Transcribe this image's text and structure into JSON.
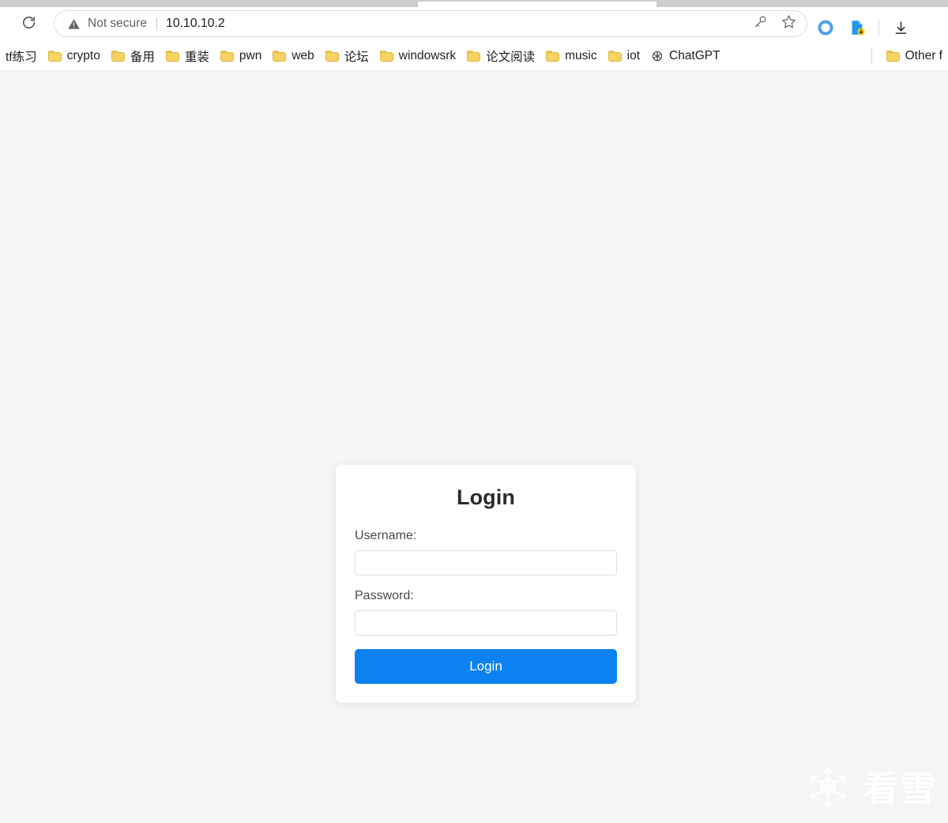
{
  "browser": {
    "tab": {
      "title": ""
    },
    "reload_label": "Reload",
    "omnibox": {
      "security_icon": "warning-triangle-icon",
      "security_label": "Not secure",
      "url": "10.10.10.2",
      "action_icons": [
        "key-icon",
        "star-icon"
      ]
    },
    "toolbar_icons": [
      "copilot-icon",
      "downloads-page-icon",
      "download-icon"
    ],
    "bookmarks": {
      "items": [
        {
          "label": "tf练习",
          "icon": "folder-icon"
        },
        {
          "label": "crypto",
          "icon": "folder-icon"
        },
        {
          "label": "备用",
          "icon": "folder-icon"
        },
        {
          "label": "重装",
          "icon": "folder-icon"
        },
        {
          "label": "pwn",
          "icon": "folder-icon"
        },
        {
          "label": "web",
          "icon": "folder-icon"
        },
        {
          "label": "论坛",
          "icon": "folder-icon"
        },
        {
          "label": "windowsrk",
          "icon": "folder-icon"
        },
        {
          "label": "论文阅读",
          "icon": "folder-icon"
        },
        {
          "label": "music",
          "icon": "folder-icon"
        },
        {
          "label": "iot",
          "icon": "folder-icon"
        },
        {
          "label": "ChatGPT",
          "icon": "openai-icon"
        }
      ],
      "other_folder": {
        "label": "Other f",
        "icon": "folder-icon"
      }
    }
  },
  "page": {
    "background_color": "#f5f5f5",
    "login": {
      "title": "Login",
      "username_label": "Username:",
      "username_value": "",
      "username_placeholder": "",
      "password_label": "Password:",
      "password_value": "",
      "password_placeholder": "",
      "submit_label": "Login",
      "accent_color": "#0b82ef"
    },
    "watermark": {
      "icon": "snowflake-icon",
      "text": "看雪",
      "color": "#ffffff"
    }
  }
}
